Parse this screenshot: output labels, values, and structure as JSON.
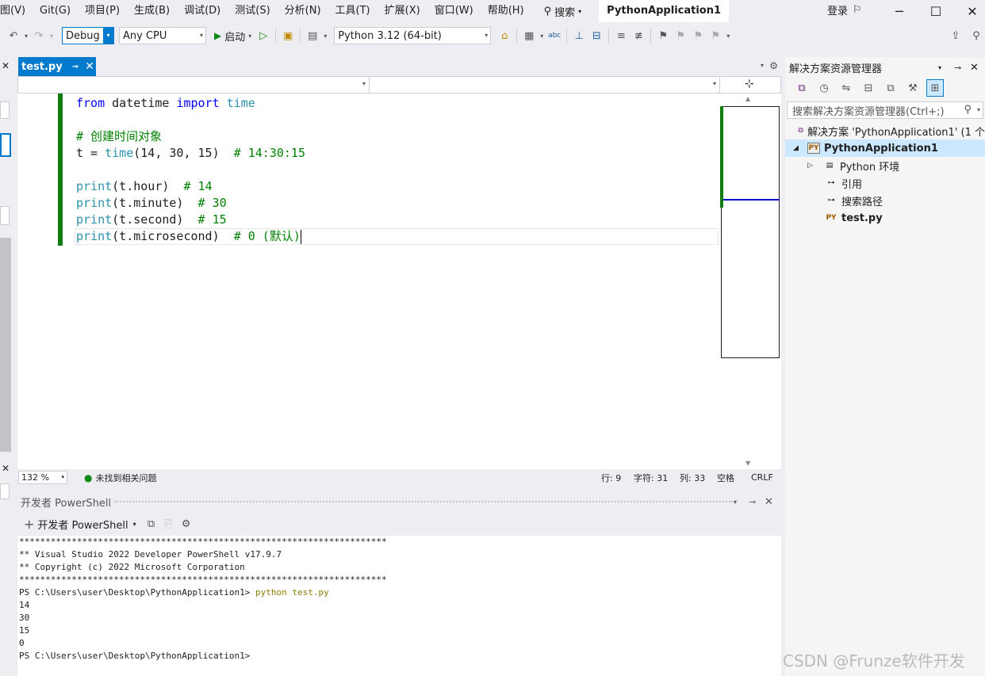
{
  "menubar": {
    "items": [
      "图(V)",
      "Git(G)",
      "项目(P)",
      "生成(B)",
      "调试(D)",
      "测试(S)",
      "分析(N)",
      "工具(T)",
      "扩展(X)",
      "窗口(W)",
      "帮助(H)"
    ],
    "search_label": "搜索",
    "app_title": "PythonApplication1",
    "login_label": "登录"
  },
  "toolbar": {
    "config": "Debug",
    "platform": "Any CPU",
    "start_label": "启动",
    "python_env": "Python 3.12 (64-bit)"
  },
  "editor": {
    "tab_label": "test.py",
    "code_lines": [
      [
        {
          "t": "from",
          "c": "kw"
        },
        {
          "t": " datetime "
        },
        {
          "t": "import",
          "c": "kw"
        },
        {
          "t": " "
        },
        {
          "t": "time",
          "c": "fn"
        }
      ],
      [],
      [
        {
          "t": "# 创建时间对象",
          "c": "cm"
        }
      ],
      [
        {
          "t": "t = "
        },
        {
          "t": "time",
          "c": "fn"
        },
        {
          "t": "(14, 30, 15)  "
        },
        {
          "t": "# 14:30:15",
          "c": "cm"
        }
      ],
      [],
      [
        {
          "t": "print",
          "c": "fn"
        },
        {
          "t": "(t.hour)  "
        },
        {
          "t": "# 14",
          "c": "cm"
        }
      ],
      [
        {
          "t": "print",
          "c": "fn"
        },
        {
          "t": "(t.minute)  "
        },
        {
          "t": "# 30",
          "c": "cm"
        }
      ],
      [
        {
          "t": "print",
          "c": "fn"
        },
        {
          "t": "(t.second)  "
        },
        {
          "t": "# 15",
          "c": "cm"
        }
      ],
      [
        {
          "t": "print",
          "c": "fn"
        },
        {
          "t": "(t.microsecond)  "
        },
        {
          "t": "# 0 (默认)",
          "c": "cm"
        }
      ]
    ],
    "zoom": "132 %",
    "issues_label": "未找到相关问题",
    "row_label": "行: 9",
    "char_label": "字符: 31",
    "col_label": "列: 33",
    "space_label": "空格",
    "eol_label": "CRLF"
  },
  "solution_explorer": {
    "title": "解决方案资源管理器",
    "search_placeholder": "搜索解决方案资源管理器(Ctrl+;)",
    "solution_label": "解决方案 'PythonApplication1' (1 个",
    "project_label": "PythonApplication1",
    "env_label": "Python 环境",
    "ref_label": "引用",
    "search_path_label": "搜索路径",
    "file_label": "test.py"
  },
  "terminal": {
    "title": "开发者 PowerShell",
    "new_label": "开发者 PowerShell",
    "lines": [
      "**********************************************************************",
      "** Visual Studio 2022 Developer PowerShell v17.9.7",
      "** Copyright (c) 2022 Microsoft Corporation",
      "**********************************************************************"
    ],
    "prompt": "PS C:\\Users\\user\\Desktop\\PythonApplication1> ",
    "command": "python test.py",
    "output": [
      "14",
      "30",
      "15",
      "0"
    ],
    "final_prompt": "PS C:\\Users\\user\\Desktop\\PythonApplication1>"
  },
  "watermark": "CSDN @Frunze软件开发"
}
